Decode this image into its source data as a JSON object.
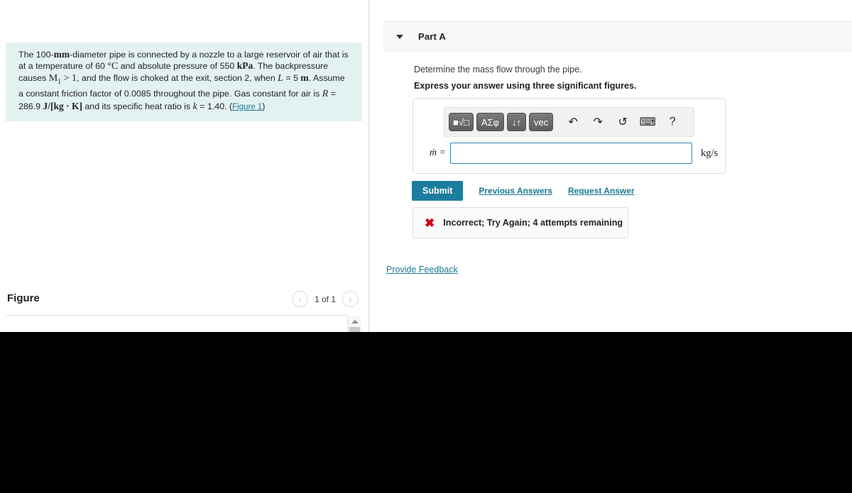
{
  "problem": {
    "text_parts": {
      "p1": "The 100-",
      "unit_mm": "mm",
      "p2": "-diameter pipe is connected by a nozzle to a large reservoir of air that is at a temperature of 60 ",
      "deg_c": "°C",
      "p3": " and absolute pressure of 550 ",
      "unit_kpa": "kPa",
      "p4": ". The backpressure causes ",
      "mach": "M",
      "mach_sub": "1",
      "mach_rel": " > 1",
      "p5": ", and the flow is choked at the exit, section 2, when ",
      "var_l": "L",
      "p6": " = 5 ",
      "unit_m": "m",
      "p7": ". Assume a constant friction factor of 0.0085 throughout the pipe. Gas constant for air is ",
      "var_r": "R",
      "p8": " = 286.9 ",
      "unit_r": "J/[kg · K]",
      "p9": " and its specific heat ratio is ",
      "var_k": "k",
      "p10": " = 1.40. (",
      "figure_link": "Figure 1",
      "p11": ")"
    }
  },
  "figure_panel": {
    "title": "Figure",
    "prev_icon": "‹",
    "next_icon": "›",
    "counter": "1 of 1"
  },
  "part": {
    "label": "Part A",
    "question": "Determine the mass flow through the pipe.",
    "instruction": "Express your answer using three significant figures."
  },
  "math_toolbar": {
    "buttons": [
      {
        "name": "math-template-button",
        "glyph": "■√□"
      },
      {
        "name": "greek-symbols-button",
        "glyph": "ΑΣφ"
      },
      {
        "name": "sort-arrows-button",
        "glyph": "↓↑"
      },
      {
        "name": "vector-button",
        "glyph": "vec"
      }
    ],
    "icons": [
      {
        "name": "undo-icon",
        "glyph": "↶"
      },
      {
        "name": "redo-icon",
        "glyph": "↷"
      },
      {
        "name": "reset-icon",
        "glyph": "↺"
      },
      {
        "name": "keyboard-icon",
        "glyph": "⌨"
      },
      {
        "name": "help-icon",
        "glyph": "?"
      }
    ]
  },
  "answer": {
    "variable_label": "ṁ =",
    "value": "",
    "placeholder": "",
    "unit": "kg/s"
  },
  "actions": {
    "submit_label": "Submit",
    "previous_answers_label": "Previous Answers",
    "request_answer_label": "Request Answer",
    "provide_feedback_label": "Provide Feedback"
  },
  "result": {
    "icon": "✖",
    "message": "Incorrect; Try Again; 4 attempts remaining",
    "color": "#d0021b"
  },
  "colors": {
    "statement_bg": "#e3f2f1",
    "link": "#1b7a93",
    "submit_bg": "#1c7d9e",
    "input_border": "#2d8ab3",
    "header_bg": "#f7f7f7",
    "toolbar_btn": "#6b6b6b"
  }
}
